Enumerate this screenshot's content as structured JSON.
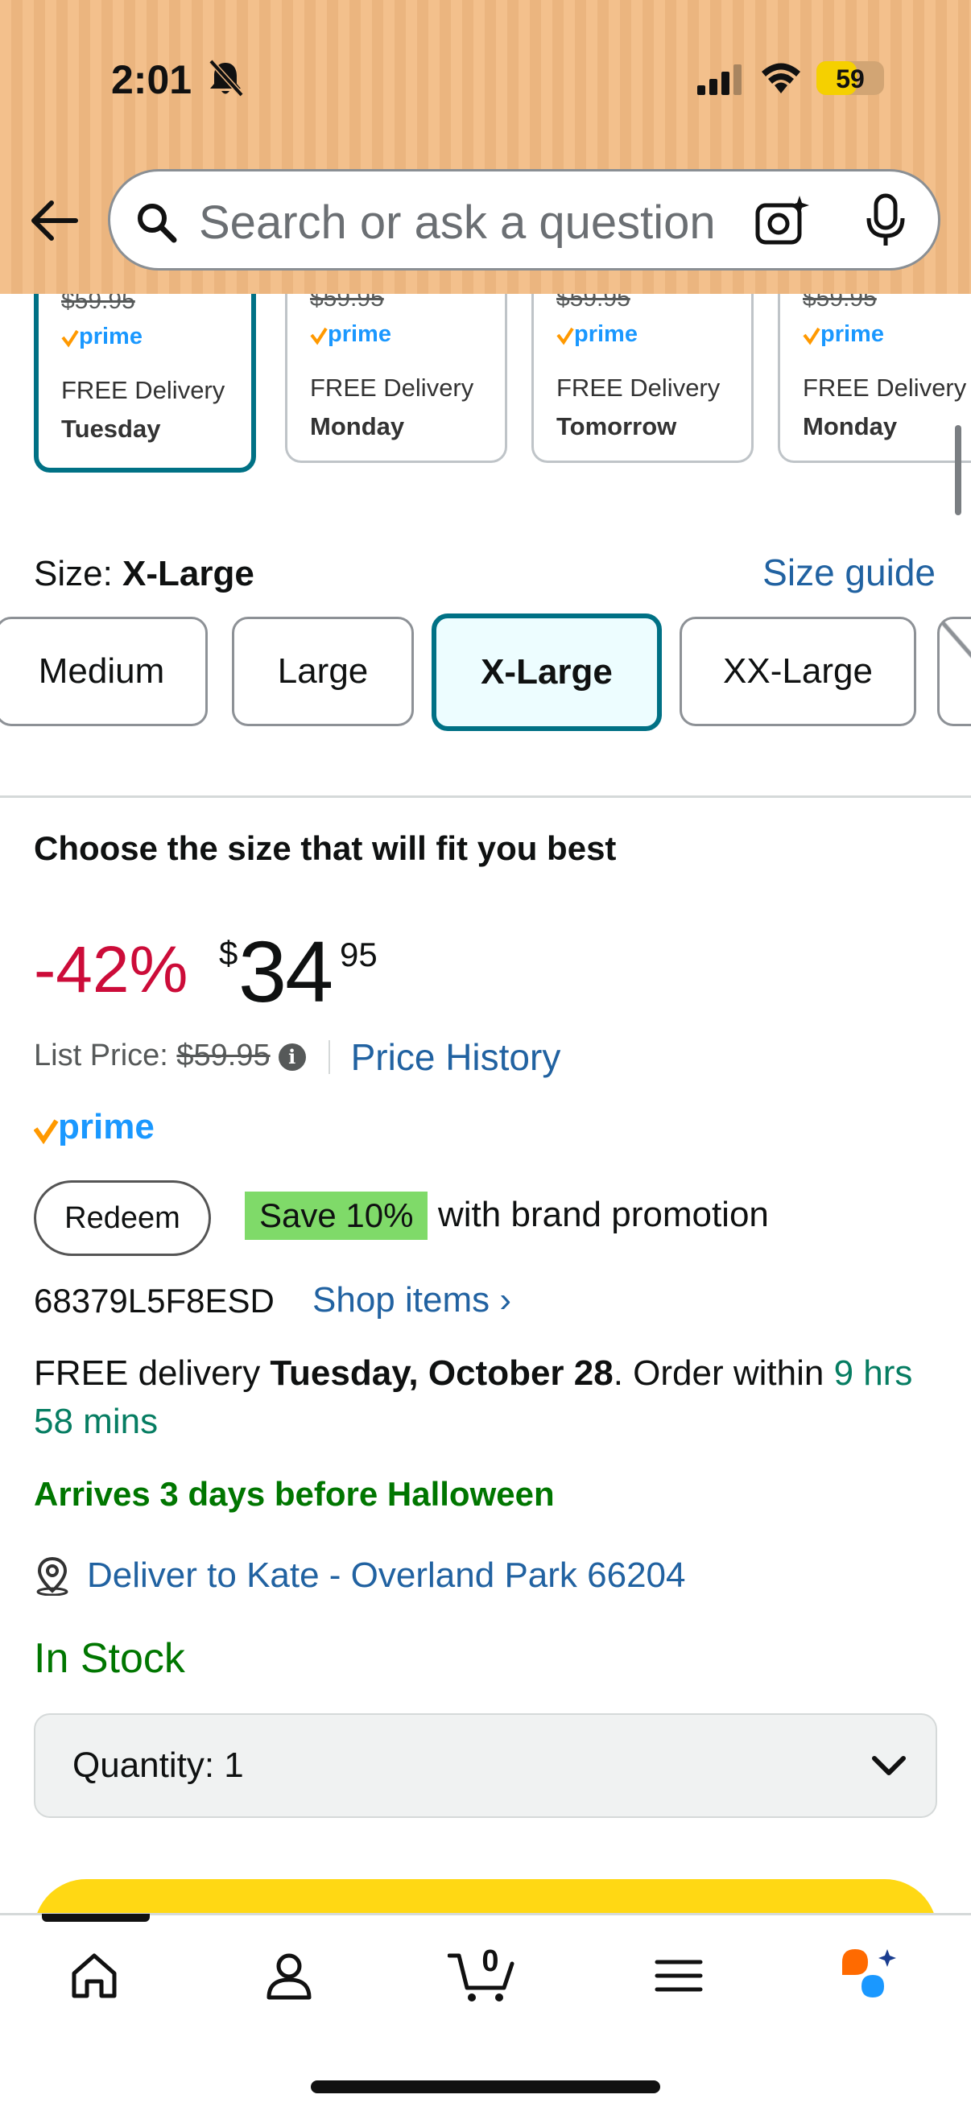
{
  "status_bar": {
    "time": "2:01",
    "battery": "59",
    "battery_fraction": 0.59
  },
  "search": {
    "placeholder": "Search or ask a question"
  },
  "delivery_cards": [
    {
      "price": "$59.95",
      "free": "FREE Delivery",
      "day": "Tuesday",
      "selected": true
    },
    {
      "price": "$59.95",
      "free": "FREE Delivery",
      "day": "Monday",
      "selected": false
    },
    {
      "price": "$59.95",
      "free": "FREE Delivery",
      "day": "Tomorrow",
      "selected": false
    },
    {
      "price": "$59.95",
      "free": "FREE Delivery",
      "day": "Monday",
      "selected": false
    }
  ],
  "prime_badge": "prime",
  "size": {
    "label": "Size: ",
    "value": "X-Large",
    "guide": "Size guide",
    "options": [
      {
        "label": "Medium",
        "selected": false
      },
      {
        "label": "Large",
        "selected": false
      },
      {
        "label": "X-Large",
        "selected": true
      },
      {
        "label": "XX-Large",
        "selected": false
      },
      {
        "label": "",
        "selected": false,
        "unavailable": true
      }
    ]
  },
  "buybox": {
    "fit_heading": "Choose the size that will fit you best",
    "discount": "-42%",
    "currency": "$",
    "price_whole": "34",
    "price_fraction": "95",
    "list_price_label": "List Price: ",
    "list_price": "$59.95",
    "info_icon": "i",
    "price_history": "Price History",
    "prime": "prime",
    "redeem": "Redeem",
    "save_badge": "Save 10%",
    "promo_text": "with brand promotion",
    "seller_code": "68379L5F8ESD",
    "shop_items": "Shop items ›",
    "delivery_prefix": "FREE delivery ",
    "delivery_date": "Tuesday, October 28",
    "delivery_mid": ". Order within ",
    "delivery_countdown": "9 hrs 58 mins",
    "arrives": "Arrives 3 days before Halloween",
    "deliver_to": "Deliver to Kate - Overland Park 66204",
    "stock": "In Stock",
    "quantity": "Quantity: 1"
  },
  "bottom_nav": {
    "cart_count": "0"
  },
  "colors": {
    "header": "#f3c08c",
    "teal_select": "#007185",
    "link": "#2162a1",
    "discount": "#cc0c39",
    "in_stock": "#007600",
    "save_badge": "#7fda69",
    "add_to_cart": "#ffd814",
    "prime_blue": "#1a98ff",
    "prime_check": "#ff9900"
  },
  "icons": [
    "silent-bell-icon",
    "cellular-signal-icon",
    "wifi-icon",
    "battery-icon",
    "back-arrow-icon",
    "search-icon",
    "camera-lens-icon",
    "microphone-icon",
    "info-icon",
    "location-pin-icon",
    "chevron-down-icon",
    "home-icon",
    "profile-icon",
    "cart-icon",
    "menu-icon",
    "rufus-assistant-icon"
  ]
}
